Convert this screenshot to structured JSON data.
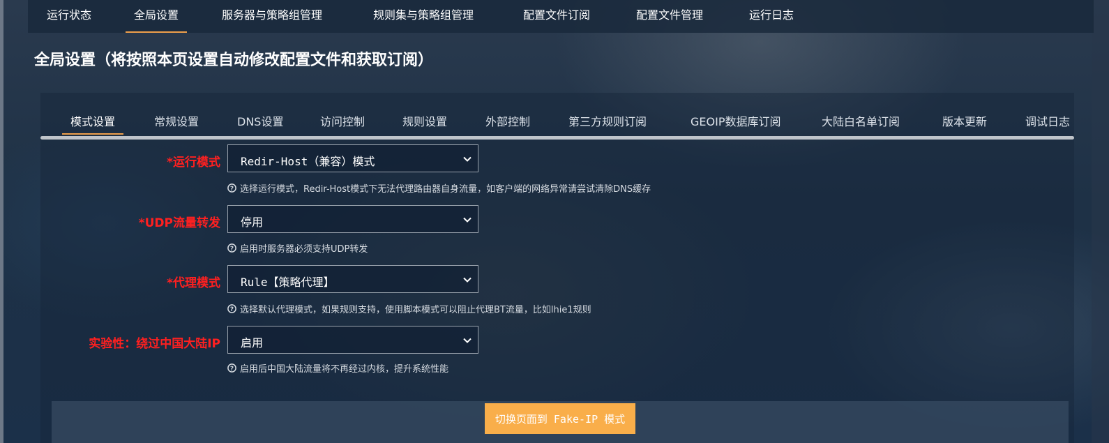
{
  "top_nav": {
    "tabs": [
      {
        "label": "运行状态",
        "active": false
      },
      {
        "label": "全局设置",
        "active": true
      },
      {
        "label": "服务器与策略组管理",
        "active": false
      },
      {
        "label": "规则集与策略组管理",
        "active": false
      },
      {
        "label": "配置文件订阅",
        "active": false
      },
      {
        "label": "配置文件管理",
        "active": false
      },
      {
        "label": "运行日志",
        "active": false
      }
    ]
  },
  "page_title": "全局设置（将按照本页设置自动修改配置文件和获取订阅）",
  "sub_tabs": [
    {
      "label": "模式设置",
      "active": true
    },
    {
      "label": "常规设置",
      "active": false
    },
    {
      "label": "DNS设置",
      "active": false
    },
    {
      "label": "访问控制",
      "active": false
    },
    {
      "label": "规则设置",
      "active": false
    },
    {
      "label": "外部控制",
      "active": false
    },
    {
      "label": "第三方规则订阅",
      "active": false
    },
    {
      "label": "GEOIP数据库订阅",
      "active": false
    },
    {
      "label": "大陆白名单订阅",
      "active": false
    },
    {
      "label": "版本更新",
      "active": false
    },
    {
      "label": "调试日志",
      "active": false
    }
  ],
  "fields": [
    {
      "label": "*运行模式",
      "value": "Redir-Host（兼容）模式",
      "hint": "选择运行模式，Redir-Host模式下无法代理路由器自身流量，如客户端的网络异常请尝试清除DNS缓存"
    },
    {
      "label": "*UDP流量转发",
      "value": "停用",
      "hint": "启用时服务器必须支持UDP转发"
    },
    {
      "label": "*代理模式",
      "value": "Rule【策略代理】",
      "hint": "选择默认代理模式，如果规则支持，使用脚本模式可以阻止代理BT流量，比如lhie1规则"
    },
    {
      "label": "实验性：绕过中国大陆IP",
      "value": "启用",
      "hint": "启用后中国大陆流量将不再经过内核，提升系统性能"
    }
  ],
  "switch_button": "切换页面到 Fake-IP 模式",
  "colors": {
    "accent": "#f0a04b",
    "label_red": "#ff2020",
    "button": "#f9ae4a"
  }
}
